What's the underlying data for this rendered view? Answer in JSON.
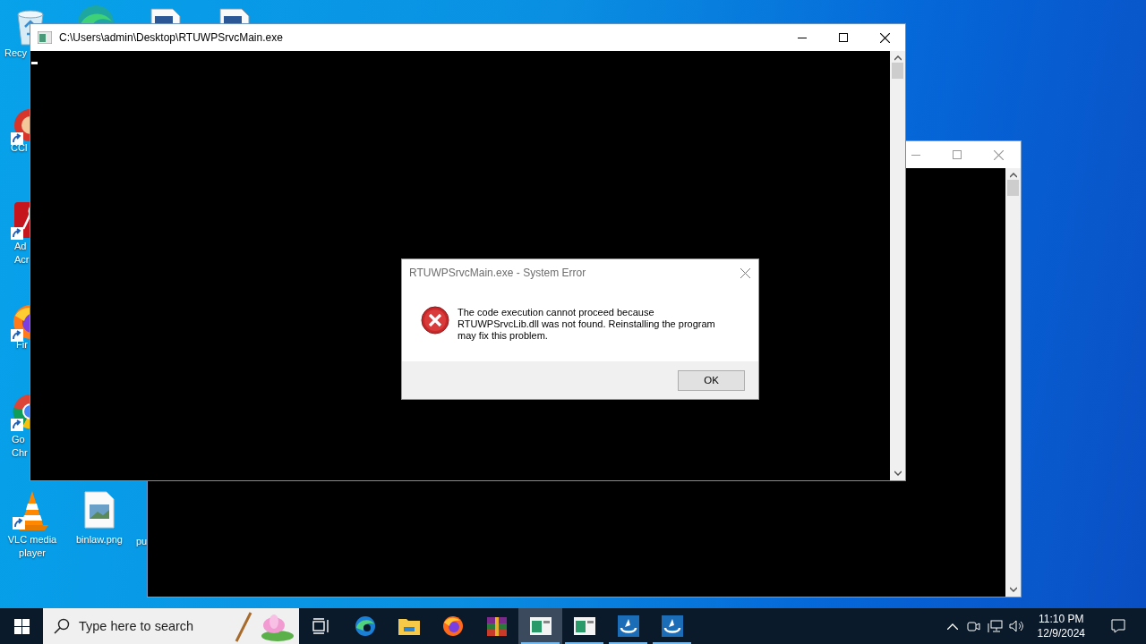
{
  "desktop_icons": [
    {
      "kind": "recycle-bin",
      "lines": [
        "Recy"
      ]
    },
    {
      "kind": "cleaner",
      "shortcut": true,
      "lines": [
        "CCl"
      ]
    },
    {
      "kind": "pdf-reader",
      "shortcut": true,
      "lines": [
        "Ad",
        "Acr"
      ]
    },
    {
      "kind": "fox-browser",
      "shortcut": true,
      "lines": [
        "Fir"
      ]
    },
    {
      "kind": "ring-browser",
      "shortcut": true,
      "lines": [
        "Go",
        "Chr"
      ]
    },
    {
      "kind": "cone",
      "shortcut": true,
      "lines": [
        "VLC media",
        "player"
      ]
    },
    {
      "kind": "image-file",
      "lines": [
        "binlaw.png"
      ]
    },
    {
      "kind": "hidden",
      "lines": [
        "pu"
      ]
    },
    {
      "kind": "wave-browser"
    },
    {
      "kind": "document"
    },
    {
      "kind": "document"
    }
  ],
  "main_window": {
    "title": "C:\\Users\\admin\\Desktop\\RTUWPSrvcMain.exe"
  },
  "dialog": {
    "title": "RTUWPSrvcMain.exe - System Error",
    "message": "The code execution cannot proceed because RTUWPSrvcLib.dll was not found. Reinstalling the program may fix this problem.",
    "buttons": [
      "OK"
    ]
  },
  "taskbar": {
    "search": {
      "placeholder": "Type here to search"
    },
    "apps": [
      {
        "kind": "wave-browser",
        "open": false,
        "active": false
      },
      {
        "kind": "folder",
        "open": false,
        "active": false
      },
      {
        "kind": "fox-browser",
        "open": false,
        "active": false
      },
      {
        "kind": "archive",
        "open": false,
        "active": false
      },
      {
        "kind": "console",
        "open": true,
        "active": true
      },
      {
        "kind": "console",
        "open": true,
        "active": false
      },
      {
        "kind": "blue-app",
        "open": true,
        "active": false
      },
      {
        "kind": "blue-app",
        "open": true,
        "active": false
      }
    ],
    "clock": {
      "time": "11:10 PM",
      "date": "12/9/2024"
    }
  }
}
